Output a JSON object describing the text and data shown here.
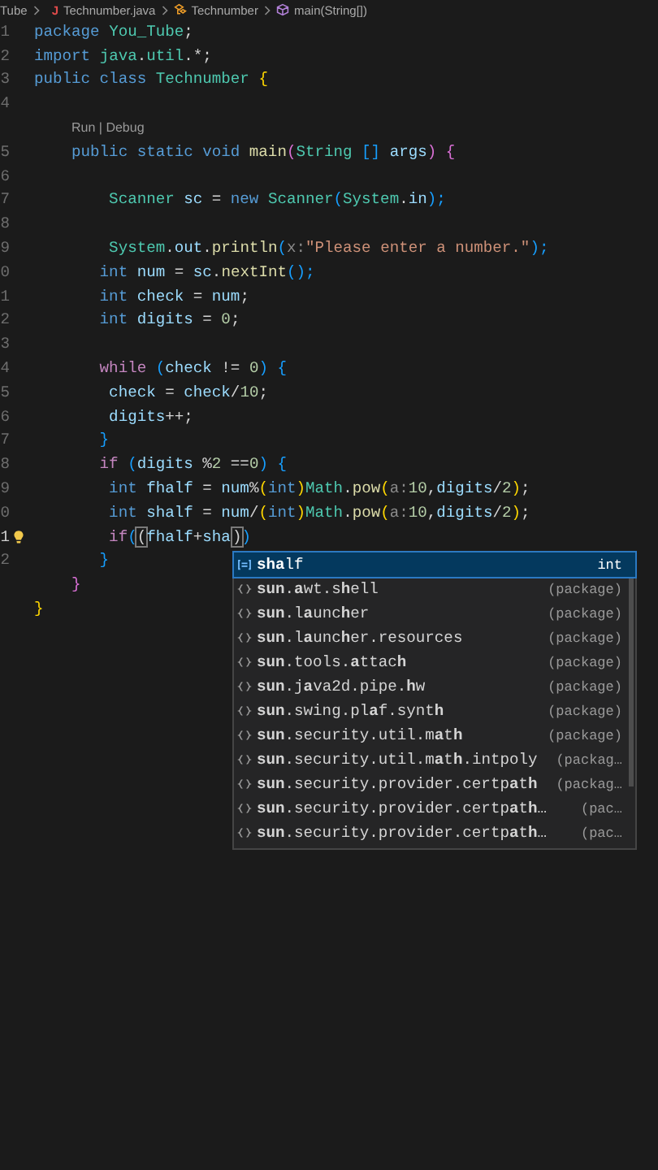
{
  "breadcrumb": [
    {
      "kind": "folder",
      "label": "Tube"
    },
    {
      "kind": "file",
      "icon_text": "J",
      "label": "Technumber.java"
    },
    {
      "kind": "class",
      "label": "Technumber"
    },
    {
      "kind": "method",
      "label": "main(String[])"
    }
  ],
  "lines": [
    {
      "kind": "code",
      "number": "1",
      "tokens": [
        {
          "text": "package ",
          "kind": "kw"
        },
        {
          "text": "You_Tube",
          "kind": "type"
        },
        {
          "text": ";",
          "kind": "p"
        }
      ]
    },
    {
      "kind": "code",
      "number": "2",
      "tokens": [
        {
          "text": "import ",
          "kind": "kw"
        },
        {
          "text": "java",
          "kind": "type"
        },
        {
          "text": ".",
          "kind": "p"
        },
        {
          "text": "util",
          "kind": "type"
        },
        {
          "text": ".*;",
          "kind": "p"
        }
      ]
    },
    {
      "kind": "code",
      "number": "3",
      "tokens": [
        {
          "text": "public class ",
          "kind": "kw"
        },
        {
          "text": "Technumber ",
          "kind": "type"
        },
        {
          "text": "{",
          "kind": "b1"
        }
      ]
    },
    {
      "kind": "code",
      "number": "4"
    },
    {
      "kind": "lens",
      "text": "Run | Debug"
    },
    {
      "kind": "code",
      "number": "5",
      "tokens": [
        {
          "text": "    public static void ",
          "kind": "kw"
        },
        {
          "text": "main",
          "kind": "fn"
        },
        {
          "text": "(",
          "kind": "b2"
        },
        {
          "text": "String ",
          "kind": "type"
        },
        {
          "text": "[] ",
          "kind": "b3"
        },
        {
          "text": "args",
          "kind": "var"
        },
        {
          "text": ") ",
          "kind": "b2"
        },
        {
          "text": "{",
          "kind": "b2"
        }
      ]
    },
    {
      "kind": "code",
      "number": "6"
    },
    {
      "kind": "code",
      "number": "7",
      "tokens": [
        {
          "text": "        Scanner ",
          "kind": "type"
        },
        {
          "text": "sc",
          "kind": "var"
        },
        {
          "text": " = ",
          "kind": "p"
        },
        {
          "text": "new ",
          "kind": "kw"
        },
        {
          "text": "Scanner",
          "kind": "type"
        },
        {
          "text": "(",
          "kind": "b3"
        },
        {
          "text": "System",
          "kind": "type"
        },
        {
          "text": ".",
          "kind": "p"
        },
        {
          "text": "in",
          "kind": "var"
        },
        {
          "text": ");",
          "kind": "b3"
        }
      ]
    },
    {
      "kind": "code",
      "number": "8"
    },
    {
      "kind": "code",
      "number": "9",
      "tokens": [
        {
          "text": "        System",
          "kind": "type"
        },
        {
          "text": ".",
          "kind": "p"
        },
        {
          "text": "out",
          "kind": "var"
        },
        {
          "text": ".",
          "kind": "p"
        },
        {
          "text": "println",
          "kind": "fn"
        },
        {
          "text": "(",
          "kind": "b3"
        },
        {
          "text": "x:",
          "kind": "hint"
        },
        {
          "text": "\"Please enter a number.\"",
          "kind": "str"
        },
        {
          "text": ");",
          "kind": "b3"
        }
      ]
    },
    {
      "kind": "code",
      "number": "0",
      "tokens": [
        {
          "text": "       int ",
          "kind": "kw"
        },
        {
          "text": "num",
          "kind": "var"
        },
        {
          "text": " = ",
          "kind": "p"
        },
        {
          "text": "sc",
          "kind": "var"
        },
        {
          "text": ".",
          "kind": "p"
        },
        {
          "text": "nextInt",
          "kind": "fn"
        },
        {
          "text": "();",
          "kind": "b3"
        }
      ]
    },
    {
      "kind": "code",
      "number": "1",
      "tokens": [
        {
          "text": "       int ",
          "kind": "kw"
        },
        {
          "text": "check",
          "kind": "var"
        },
        {
          "text": " = ",
          "kind": "p"
        },
        {
          "text": "num",
          "kind": "var"
        },
        {
          "text": ";",
          "kind": "p"
        }
      ]
    },
    {
      "kind": "code",
      "number": "2",
      "tokens": [
        {
          "text": "       int ",
          "kind": "kw"
        },
        {
          "text": "digits",
          "kind": "var"
        },
        {
          "text": " = ",
          "kind": "p"
        },
        {
          "text": "0",
          "kind": "num"
        },
        {
          "text": ";",
          "kind": "p"
        }
      ]
    },
    {
      "kind": "code",
      "number": "3"
    },
    {
      "kind": "code",
      "number": "4",
      "tokens": [
        {
          "text": "       while ",
          "kind": "ctl"
        },
        {
          "text": "(",
          "kind": "b3"
        },
        {
          "text": "check",
          "kind": "var"
        },
        {
          "text": " != ",
          "kind": "p"
        },
        {
          "text": "0",
          "kind": "num"
        },
        {
          "text": ") ",
          "kind": "b3"
        },
        {
          "text": "{",
          "kind": "b3"
        }
      ]
    },
    {
      "kind": "code",
      "number": "5",
      "tokens": [
        {
          "text": "        check",
          "kind": "var"
        },
        {
          "text": " = ",
          "kind": "p"
        },
        {
          "text": "check",
          "kind": "var"
        },
        {
          "text": "/",
          "kind": "p"
        },
        {
          "text": "10",
          "kind": "num"
        },
        {
          "text": ";",
          "kind": "p"
        }
      ]
    },
    {
      "kind": "code",
      "number": "6",
      "tokens": [
        {
          "text": "        digits",
          "kind": "var"
        },
        {
          "text": "++;",
          "kind": "p"
        }
      ]
    },
    {
      "kind": "code",
      "number": "7",
      "tokens": [
        {
          "text": "       }",
          "kind": "b3"
        }
      ]
    },
    {
      "kind": "code",
      "number": "8",
      "tokens": [
        {
          "text": "       if ",
          "kind": "ctl"
        },
        {
          "text": "(",
          "kind": "b3"
        },
        {
          "text": "digits",
          "kind": "var"
        },
        {
          "text": " %",
          "kind": "p"
        },
        {
          "text": "2",
          "kind": "num"
        },
        {
          "text": " ==",
          "kind": "p"
        },
        {
          "text": "0",
          "kind": "num"
        },
        {
          "text": ") ",
          "kind": "b3"
        },
        {
          "text": "{",
          "kind": "b3"
        }
      ]
    },
    {
      "kind": "code",
      "number": "9",
      "tokens": [
        {
          "text": "        int ",
          "kind": "kw"
        },
        {
          "text": "fhalf",
          "kind": "var"
        },
        {
          "text": " = ",
          "kind": "p"
        },
        {
          "text": "num",
          "kind": "var"
        },
        {
          "text": "%",
          "kind": "p"
        },
        {
          "text": "(",
          "kind": "b1"
        },
        {
          "text": "int",
          "kind": "kw"
        },
        {
          "text": ")",
          "kind": "b1"
        },
        {
          "text": "Math",
          "kind": "type"
        },
        {
          "text": ".",
          "kind": "p"
        },
        {
          "text": "pow",
          "kind": "fn"
        },
        {
          "text": "(",
          "kind": "b1"
        },
        {
          "text": "a:",
          "kind": "hint"
        },
        {
          "text": "10",
          "kind": "num"
        },
        {
          "text": ",",
          "kind": "p"
        },
        {
          "text": "digits",
          "kind": "var"
        },
        {
          "text": "/",
          "kind": "p"
        },
        {
          "text": "2",
          "kind": "num"
        },
        {
          "text": ")",
          "kind": "b1"
        },
        {
          "text": ";",
          "kind": "p"
        }
      ]
    },
    {
      "kind": "code",
      "number": "0",
      "tokens": [
        {
          "text": "        int ",
          "kind": "kw"
        },
        {
          "text": "shalf",
          "kind": "var"
        },
        {
          "text": " = ",
          "kind": "p"
        },
        {
          "text": "num",
          "kind": "var"
        },
        {
          "text": "/",
          "kind": "p"
        },
        {
          "text": "(",
          "kind": "b1"
        },
        {
          "text": "int",
          "kind": "kw"
        },
        {
          "text": ")",
          "kind": "b1"
        },
        {
          "text": "Math",
          "kind": "type"
        },
        {
          "text": ".",
          "kind": "p"
        },
        {
          "text": "pow",
          "kind": "fn"
        },
        {
          "text": "(",
          "kind": "b1"
        },
        {
          "text": "a:",
          "kind": "hint"
        },
        {
          "text": "10",
          "kind": "num"
        },
        {
          "text": ",",
          "kind": "p"
        },
        {
          "text": "digits",
          "kind": "var"
        },
        {
          "text": "/",
          "kind": "p"
        },
        {
          "text": "2",
          "kind": "num"
        },
        {
          "text": ")",
          "kind": "b1"
        },
        {
          "text": ";",
          "kind": "p"
        }
      ]
    },
    {
      "kind": "code",
      "number": "1",
      "active": true,
      "lightbulb": true,
      "tokens": [
        {
          "text": "        if",
          "kind": "ctl"
        },
        {
          "text": "(",
          "kind": "b3"
        },
        {
          "text": "(",
          "kind": "hl"
        },
        {
          "text": "fhalf",
          "kind": "var"
        },
        {
          "text": "+",
          "kind": "p"
        },
        {
          "text": "sha",
          "kind": "var",
          "caret": true
        },
        {
          "text": ")",
          "kind": "hl"
        },
        {
          "text": ")",
          "kind": "b3"
        }
      ]
    },
    {
      "kind": "code",
      "number": "2",
      "tokens": [
        {
          "text": "       }",
          "kind": "b3"
        }
      ]
    },
    {
      "kind": "code",
      "tokens": [
        {
          "text": "    }",
          "kind": "b2"
        }
      ]
    },
    {
      "kind": "code",
      "tokens": [
        {
          "text": "}",
          "kind": "b1"
        }
      ]
    }
  ],
  "suggestions": [
    {
      "kind": "variable",
      "label": "**sha**lf",
      "detail": "int",
      "selected": true
    },
    {
      "kind": "package",
      "label": "**sun**.**a**wt.s**h**ell",
      "detail": "(package)",
      "selected": false
    },
    {
      "kind": "package",
      "label": "**sun**.l**a**unc**h**er",
      "detail": "(package)",
      "selected": false
    },
    {
      "kind": "package",
      "label": "**sun**.l**a**unc**h**er.resources",
      "detail": "(package)",
      "selected": false
    },
    {
      "kind": "package",
      "label": "**sun**.tools.**a**ttac**h**",
      "detail": "(package)",
      "selected": false
    },
    {
      "kind": "package",
      "label": "**sun**.j**a**va2d.pipe.**h**w",
      "detail": "(package)",
      "selected": false
    },
    {
      "kind": "package",
      "label": "**sun**.swing.pl**a**f.synt**h**",
      "detail": "(package)",
      "selected": false
    },
    {
      "kind": "package",
      "label": "**sun**.security.util.m**a**t**h**",
      "detail": "(package)",
      "selected": false
    },
    {
      "kind": "package",
      "label": "**sun**.security.util.m**a**t**h**.intpoly",
      "detail": "(packag…",
      "selected": false
    },
    {
      "kind": "package",
      "label": "**sun**.security.provider.certp**a**t**h**",
      "detail": "(packag…",
      "selected": false
    },
    {
      "kind": "package",
      "label": "**sun**.security.provider.certp**a**t**h**…",
      "detail": "(pac…",
      "selected": false
    },
    {
      "kind": "package",
      "label": "**sun**.security.provider.certp**a**t**h**…",
      "detail": "(pac…",
      "selected": false
    }
  ]
}
